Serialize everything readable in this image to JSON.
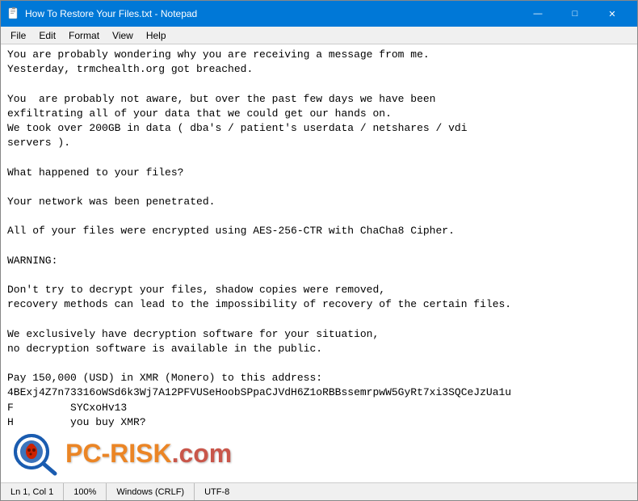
{
  "titleBar": {
    "title": "How To Restore Your Files.txt - Notepad",
    "minimizeLabel": "—",
    "maximizeLabel": "□",
    "closeLabel": "✕"
  },
  "menuBar": {
    "items": [
      "File",
      "Edit",
      "Format",
      "View",
      "Help"
    ]
  },
  "editor": {
    "content": "You are probably wondering why you are receiving a message from me.\nYesterday, trmchealth.org got breached.\n\nYou  are probably not aware, but over the past few days we have been\nexfiltrating all of your data that we could get our hands on.\nWe took over 200GB in data ( dba's / patient's userdata / netshares / vdi\nservers ).\n\nWhat happened to your files?\n\nYour network was been penetrated.\n\nAll of your files were encrypted using AES-256-CTR with ChaCha8 Cipher.\n\nWARNING:\n\nDon't try to decrypt your files, shadow copies were removed,\nrecovery methods can lead to the impossibility of recovery of the certain files.\n\nWe exclusively have decryption software for your situation,\nno decryption software is available in the public.\n\nPay 150,000 (USD) in XMR (Monero) to this address:\n4BExj4Z7n73316oWSd6k3Wj7A12PFVUSeHoobSPpaCJVdH6Z1oRBBssemrpwW5GyRt7xi3SQCeJzUa1u\nF         SYCxoHv13\nH         you buy XMR?"
  },
  "statusBar": {
    "position": "Ln 1, Col 1",
    "zoom": "100%",
    "lineEnding": "Windows (CRLF)",
    "encoding": "UTF-8"
  },
  "watermark": {
    "text": "PC-RISK",
    "suffix": ".com"
  }
}
